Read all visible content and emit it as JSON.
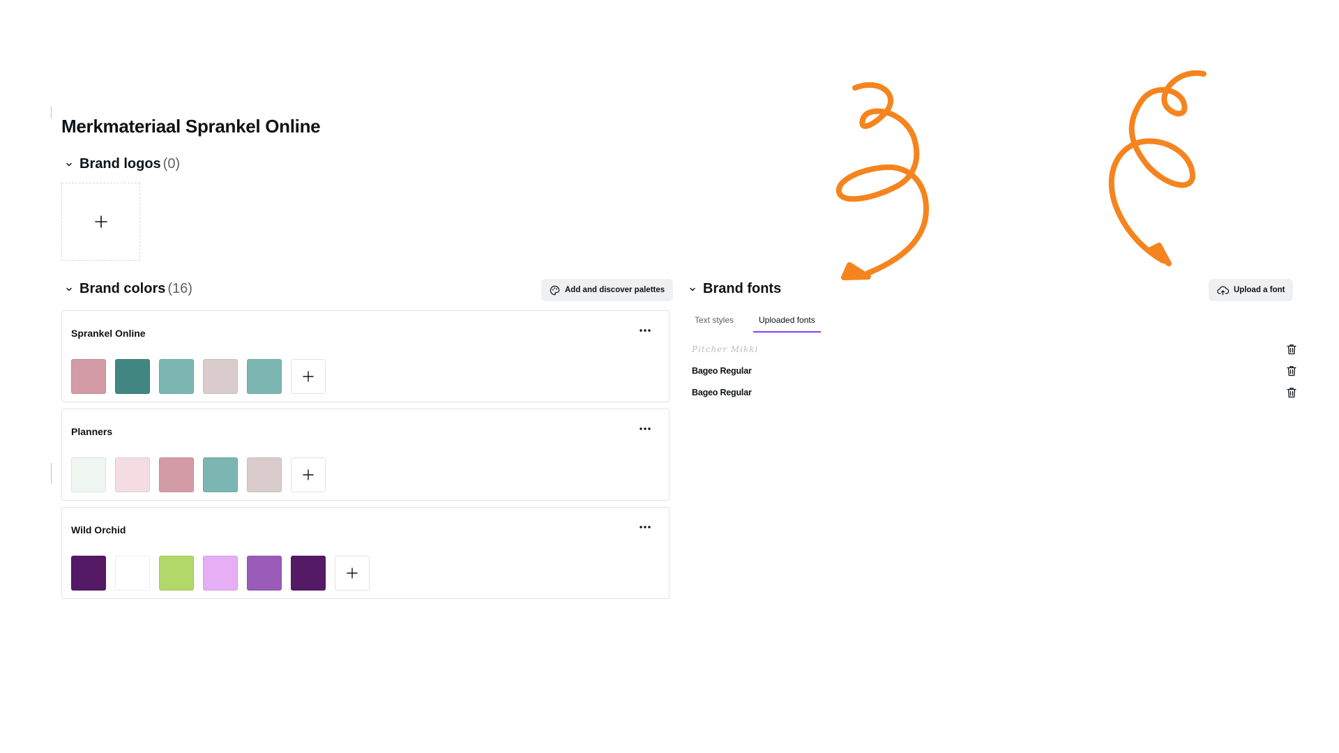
{
  "page": {
    "title": "Merkmateriaal Sprankel Online"
  },
  "logos": {
    "label": "Brand logos",
    "count": "(0)"
  },
  "colors": {
    "label": "Brand colors",
    "count": "(16)",
    "discover_button": "Add and discover palettes",
    "palettes": [
      {
        "name": "Sprankel Online",
        "swatches": [
          "#d39ba6",
          "#428681",
          "#7bb6b2",
          "#dacccd",
          "#7bb6b2"
        ]
      },
      {
        "name": "Planners",
        "swatches": [
          "#eff6f2",
          "#f5dce3",
          "#d39ba6",
          "#7bb6b2",
          "#dacccd"
        ]
      },
      {
        "name": "Wild Orchid",
        "swatches": [
          "#541a66",
          "#ffffff",
          "#b1d868",
          "#e5aef5",
          "#9b5cb9",
          "#541a66"
        ]
      }
    ]
  },
  "fonts": {
    "label": "Brand fonts",
    "upload_button": "Upload a font",
    "tabs": [
      {
        "label": "Text styles",
        "active": false
      },
      {
        "label": "Uploaded fonts",
        "active": true
      }
    ],
    "items": [
      {
        "name": "Pitcher Mikki"
      },
      {
        "name": "Bageo Regular"
      },
      {
        "name": "Bageo Regular"
      }
    ]
  },
  "decoration_color": "#f5841f"
}
